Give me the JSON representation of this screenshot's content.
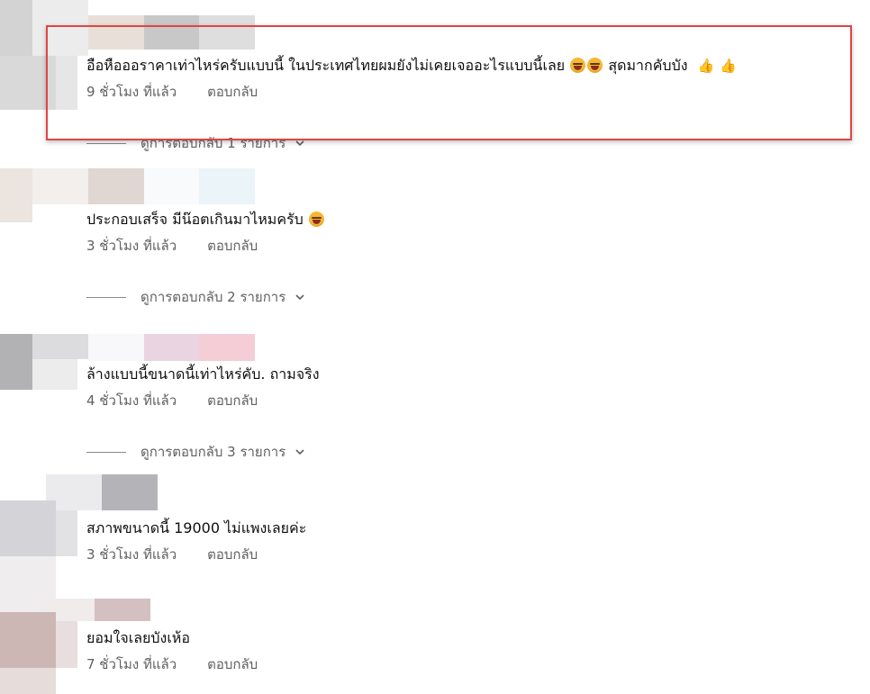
{
  "comments": [
    {
      "text_part1": "อือหือออราคาเท่าไหร่ครับแบบนี้ ในประเทศไทยผมยังไม่เคยเจออะไรแบบนี้เลย",
      "text_part2": "สุดมากคับบัง",
      "time": "9 ชั่วโมง ที่แล้ว",
      "reply": "ตอบกลับ",
      "view_replies": "ดูการตอบกลับ 1 รายการ"
    },
    {
      "text_part1": "ประกอบเสร็จ มีน๊อตเกินมาไหมครับ",
      "time": "3 ชั่วโมง ที่แล้ว",
      "reply": "ตอบกลับ",
      "view_replies": "ดูการตอบกลับ 2 รายการ"
    },
    {
      "text_part1": "ล้างแบบนี้ขนาดนี้เท่าไหร่คับ. ถามจริง",
      "time": "4 ชั่วโมง ที่แล้ว",
      "reply": "ตอบกลับ",
      "view_replies": "ดูการตอบกลับ 3 รายการ"
    },
    {
      "text_part1": "สภาพขนาดนี้ 19000 ไม่แพงเลยค่ะ",
      "time": "3 ชั่วโมง ที่แล้ว",
      "reply": "ตอบกลับ"
    },
    {
      "text_part1": "ยอมใจเลยบังเห้อ",
      "time": "7 ชั่วโมง ที่แล้ว",
      "reply": "ตอบกลับ"
    }
  ],
  "colors": {
    "highlight_border": "#e04545",
    "meta_text": "#606060",
    "main_text": "#0f0f0f"
  }
}
